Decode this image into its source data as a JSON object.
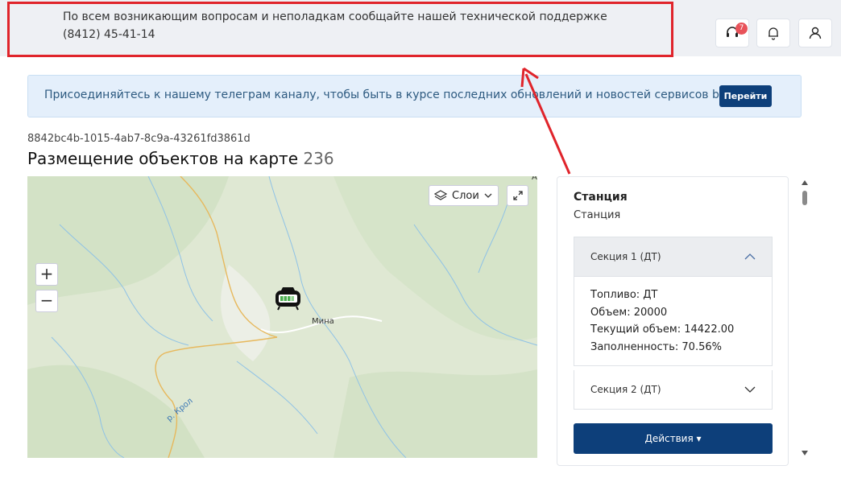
{
  "notice": {
    "text": "По всем возникающим вопросам и неполадкам сообщайте нашей технической поддержке (8412) 45-41-14"
  },
  "header": {
    "support_badge": "7"
  },
  "telegram_banner": {
    "text": "Присоединяйтесь к нашему телеграм каналу, чтобы быть в курсе последних обновлений и новостей сервисов benzamat",
    "button_label": "Перейти"
  },
  "page": {
    "id": "8842bc4b-1015-4ab7-8c9a-43261fd3861d",
    "title": "Размещение объектов на карте",
    "count": "236"
  },
  "map": {
    "layers_label": "Слои",
    "zoom_in": "+",
    "zoom_out": "−",
    "place_label": "Мина",
    "river_label": "р. Крол",
    "corner_label": "А"
  },
  "panel": {
    "title": "Станция",
    "subtitle": "Станция",
    "section1": {
      "label": "Секция 1 (ДТ)",
      "fuel": "Топливо: ДТ",
      "volume": "Объем: 20000",
      "current": "Текущий объем: 14422.00",
      "fill": "Заполненность: 70.56%"
    },
    "section2": {
      "label": "Секция 2 (ДТ)"
    },
    "actions_label": "Действия ▾"
  },
  "colors": {
    "accent": "#0d3f7a",
    "annotation_red": "#e0242b"
  }
}
